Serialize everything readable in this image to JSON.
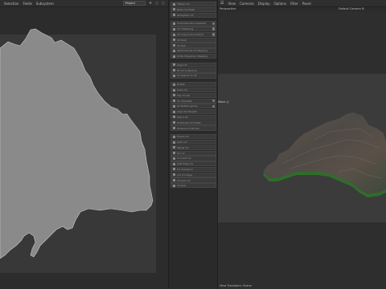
{
  "uv_editor": {
    "menu": [
      "Selection",
      "Fields",
      "Subsystem"
    ],
    "project_select": "Project",
    "icons": [
      "gear-icon",
      "square-icon",
      "square-icon"
    ]
  },
  "tool_panel": {
    "groups": [
      [
        {
          "label": "Flatten UV",
          "gear": false
        },
        {
          "label": "Relax UV Mesh",
          "gear": false
        },
        {
          "label": "Straighten UV",
          "gear": false
        }
      ],
      [
        {
          "label": "Unfold Borders Selected",
          "gear": true
        },
        {
          "label": "UV Flattening",
          "gear": true
        },
        {
          "label": "UV Layout and Unfold",
          "gear": true
        },
        {
          "label": "UV Pack",
          "gear": false
        },
        {
          "label": "UV Pelt",
          "gear": false
        },
        {
          "label": "Optimize the UV Mapping",
          "gear": false
        },
        {
          "label": "Ortho Projection Mapping",
          "gear": false
        }
      ],
      [
        {
          "label": "Align UV",
          "gear": false
        },
        {
          "label": "Fit UV to Bounds",
          "gear": false
        },
        {
          "label": "UV Islands to UV",
          "gear": false
        }
      ],
      [
        {
          "label": "Rotate",
          "gear": false
        },
        {
          "label": "Scale UV",
          "gear": false
        },
        {
          "label": "Flip UV Set",
          "gear": false
        },
        {
          "label": "UV Translate",
          "gear": true
        },
        {
          "label": "UV Rotate Ignore",
          "gear": true
        },
        {
          "label": "Align Sel Neighb",
          "gear": false
        },
        {
          "label": "Stitch UV",
          "gear": false
        },
        {
          "label": "Distribute UV Shells",
          "gear": false
        },
        {
          "label": "Distance to Border",
          "gear": false
        }
      ],
      [
        {
          "label": "Freeze UV",
          "gear": false
        },
        {
          "label": "Grab UV",
          "gear": false
        },
        {
          "label": "Merge UV",
          "gear": false
        },
        {
          "label": "Pin UV",
          "gear": false
        },
        {
          "label": "Connect UV",
          "gear": false
        },
        {
          "label": "Split Edge UV",
          "gear": false
        },
        {
          "label": "UV Transform",
          "gear": false
        },
        {
          "label": "Cut UV Edge",
          "gear": false
        },
        {
          "label": "Smooth UV",
          "gear": false
        },
        {
          "label": "Sample",
          "gear": false
        }
      ]
    ]
  },
  "viewport": {
    "menu": [
      "View",
      "Cameras",
      "Display",
      "Options",
      "Filter",
      "Panel"
    ],
    "view_label": "Perspective",
    "camera_label": "Default Camera",
    "axis_label": "Move",
    "status": "View Transform: Scene"
  }
}
